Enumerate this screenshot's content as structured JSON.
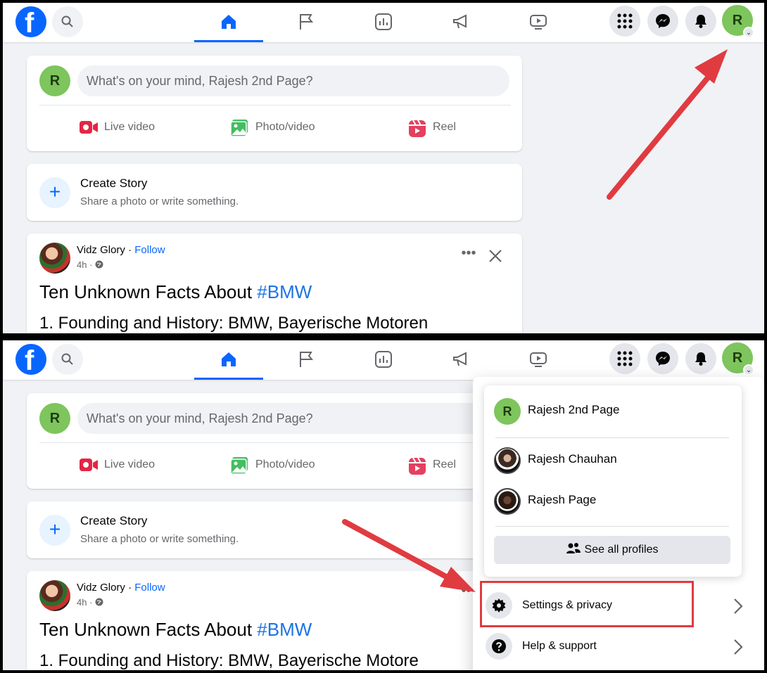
{
  "topbar": {
    "logo_text": "f",
    "icons": [
      "facebook-logo",
      "search-icon",
      "home-icon",
      "flag-icon",
      "insights-icon",
      "megaphone-icon",
      "video-icon",
      "menu-grid-icon",
      "messenger-icon",
      "bell-icon"
    ],
    "profile_initial": "R",
    "accent_color": "#0866ff"
  },
  "composer": {
    "avatar_initial": "R",
    "placeholder": "What's on your mind, Rajesh 2nd Page?",
    "actions": [
      {
        "label": "Live video",
        "color": "#e42645"
      },
      {
        "label": "Photo/video",
        "color": "#45bd62"
      },
      {
        "label": "Reel",
        "color": "#e4405f"
      }
    ]
  },
  "story": {
    "title": "Create Story",
    "subtitle": "Share a photo or write something."
  },
  "post": {
    "author": "Vidz Glory",
    "separator": " · ",
    "follow": "Follow",
    "time": "4h · ",
    "headline": "Ten Unknown Facts About ",
    "hashtag": "#BMW",
    "body_top": "1. Founding and History: BMW, Bayerische Motoren",
    "body_bottom": "1. Founding and History: BMW, Bayerische Motore"
  },
  "menu": {
    "profiles": [
      {
        "name": "Rajesh 2nd Page",
        "initial": "R"
      },
      {
        "name": "Rajesh Chauhan"
      },
      {
        "name": "Rajesh Page"
      }
    ],
    "see_all": "See all profiles",
    "items": [
      {
        "label": "Settings & privacy",
        "icon": "gear-icon"
      },
      {
        "label": "Help & support",
        "icon": "help-icon"
      }
    ]
  },
  "annotations": {
    "arrow_color": "#e03b40",
    "highlight_color": "#e03b40"
  }
}
